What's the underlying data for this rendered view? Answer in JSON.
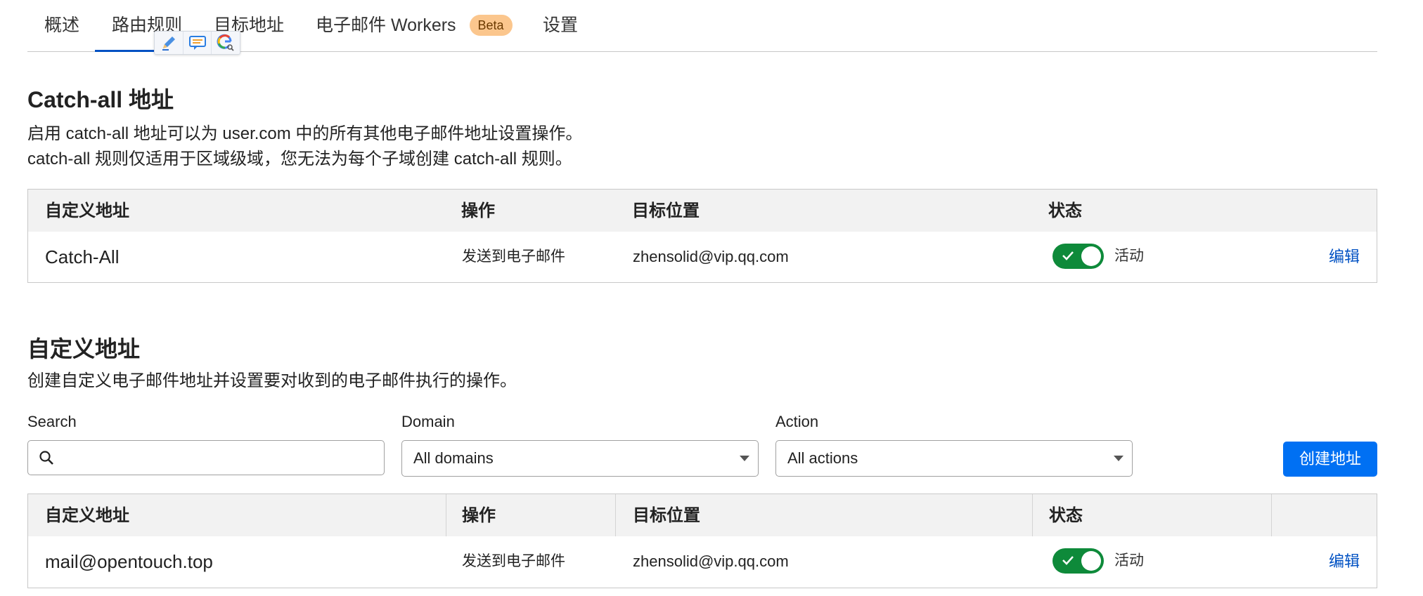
{
  "tabs": [
    {
      "label": "概述"
    },
    {
      "label": "路由规则",
      "active": true
    },
    {
      "label": "目标地址"
    },
    {
      "label": "电子邮件 Workers",
      "badge": "Beta"
    },
    {
      "label": "设置"
    }
  ],
  "extension_toolbar": {
    "icons": [
      "pencil-icon",
      "comment-icon",
      "google-search-icon"
    ]
  },
  "catch_all": {
    "title": "Catch-all 地址",
    "description_line1": "启用 catch-all 地址可以为 user.com 中的所有其他电子邮件地址设置操作。",
    "description_line2": "catch-all 规则仅适用于区域级域，您无法为每个子域创建 catch-all 规则。",
    "table": {
      "headers": {
        "address": "自定义地址",
        "action": "操作",
        "destination": "目标位置",
        "status": "状态"
      },
      "rows": [
        {
          "address": "Catch-All",
          "action": "发送到电子邮件",
          "destination": "zhensolid@vip.qq.com",
          "enabled": true,
          "status": "活动",
          "edit": "编辑"
        }
      ]
    }
  },
  "custom": {
    "title": "自定义地址",
    "description": "创建自定义电子邮件地址并设置要对收到的电子邮件执行的操作。",
    "filters": {
      "search_label": "Search",
      "search_value": "",
      "domain_label": "Domain",
      "domain_value": "All domains",
      "action_label": "Action",
      "action_value": "All actions"
    },
    "create_button": "创建地址",
    "table": {
      "headers": {
        "address": "自定义地址",
        "action": "操作",
        "destination": "目标位置",
        "status": "状态"
      },
      "rows": [
        {
          "address": "mail@opentouch.top",
          "action": "发送到电子邮件",
          "destination": "zhensolid@vip.qq.com",
          "enabled": true,
          "status": "活动",
          "edit": "编辑"
        }
      ]
    }
  },
  "colors": {
    "accent": "#0051c3",
    "button": "#0070f3",
    "toggle_on": "#0e8a3a",
    "beta_badge": "#fbc68d"
  }
}
